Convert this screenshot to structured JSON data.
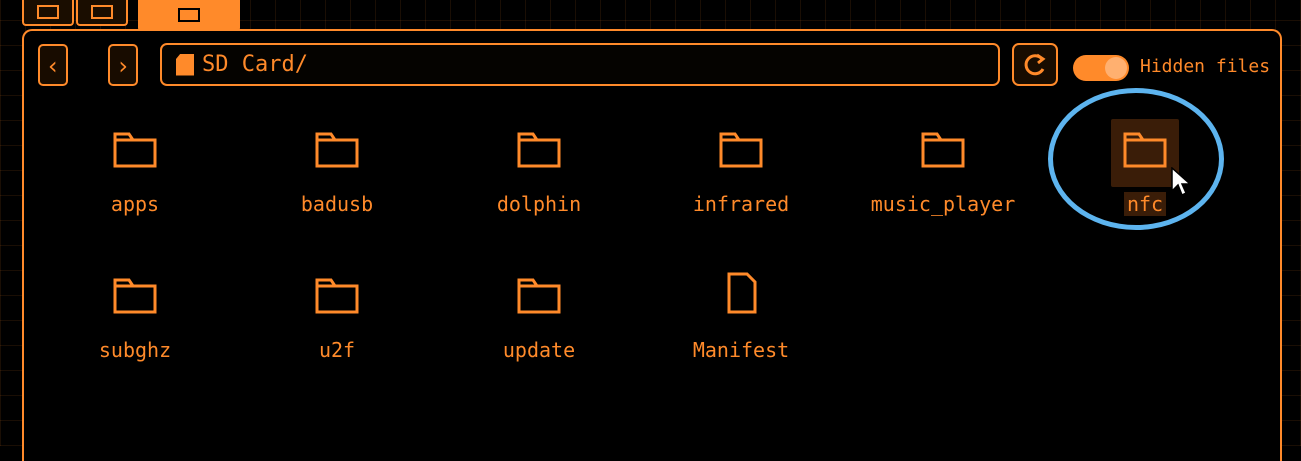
{
  "path": {
    "text": "SD Card/"
  },
  "toolbar": {
    "hidden_files_label": "Hidden files",
    "hidden_files_on": true
  },
  "items": [
    {
      "label": "apps",
      "type": "folder"
    },
    {
      "label": "badusb",
      "type": "folder"
    },
    {
      "label": "dolphin",
      "type": "folder"
    },
    {
      "label": "infrared",
      "type": "folder"
    },
    {
      "label": "music_player",
      "type": "folder"
    },
    {
      "label": "nfc",
      "type": "folder",
      "selected": true
    },
    {
      "label": "subghz",
      "type": "folder"
    },
    {
      "label": "u2f",
      "type": "folder"
    },
    {
      "label": "update",
      "type": "folder"
    },
    {
      "label": "Manifest",
      "type": "file"
    }
  ],
  "colors": {
    "accent": "#ff8a2a",
    "highlight": "#5db4ef",
    "background": "#000000"
  },
  "icons": {
    "back": "chevron-left-icon",
    "forward": "chevron-right-icon",
    "refresh": "refresh-icon",
    "sd": "sd-card-icon"
  }
}
